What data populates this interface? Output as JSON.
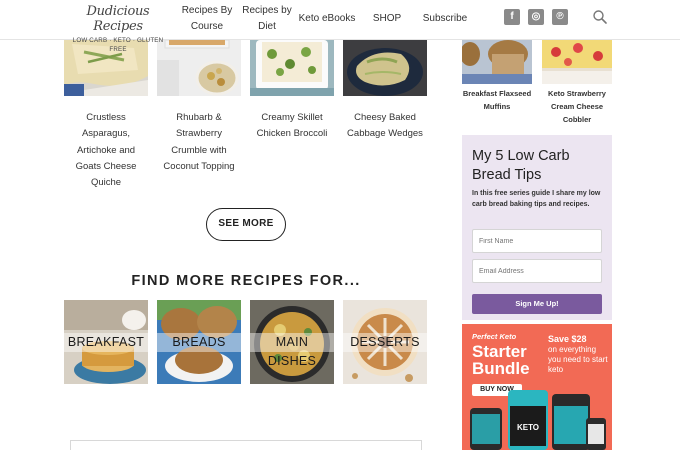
{
  "header": {
    "logo_script": "Dudicious Recipes",
    "logo_sub": "LOW CARB · KETO · GLUTEN FREE",
    "nav": {
      "course_line1": "Recipes By",
      "course_line2": "Course",
      "diet_line1": "Recipes by",
      "diet_line2": "Diet",
      "ebooks": "Keto eBooks",
      "shop": "SHOP",
      "subscribe": "Subscribe"
    },
    "social": [
      "facebook-icon",
      "instagram-icon",
      "pinterest-icon"
    ],
    "social_glyphs": [
      "f",
      "◎",
      "℗"
    ],
    "search_icon": "search-icon"
  },
  "recipes": [
    {
      "title": "Crustless Asparagus, Artichoke and Goats Cheese Quiche"
    },
    {
      "title": "Rhubarb & Strawberry Crumble with Coconut Topping"
    },
    {
      "title": "Creamy Skillet Chicken Broccoli"
    },
    {
      "title": "Cheesy Baked Cabbage Wedges"
    }
  ],
  "see_more": "SEE MORE",
  "find_more_title": "FIND MORE RECIPES FOR...",
  "categories": [
    "BREAKFAST",
    "BREADS",
    "MAIN DISHES",
    "DESSERTS"
  ],
  "sidebar": {
    "recipes": [
      {
        "title": "Breakfast Flaxseed Muffins"
      },
      {
        "title": "Keto Strawberry Cream Cheese Cobbler"
      }
    ],
    "signup": {
      "heading": "My 5 Low Carb Bread Tips",
      "text": "In this free series guide I share my low carb bread baking tips and recipes.",
      "first_name_placeholder": "First Name",
      "email_placeholder": "Email Address",
      "button": "Sign Me Up!"
    },
    "ad": {
      "kicker": "Perfect Keto",
      "title": "Starter Bundle",
      "save": "Save $28",
      "copy": "on everything you need to start keto",
      "button": "BUY NOW",
      "brand_mark": "KETO"
    }
  },
  "colors": {
    "signup_bg": "#ece5f1",
    "signup_button": "#7a5a9e",
    "ad_bg": "#f26a55",
    "social_icon": "#8a8a8a"
  }
}
